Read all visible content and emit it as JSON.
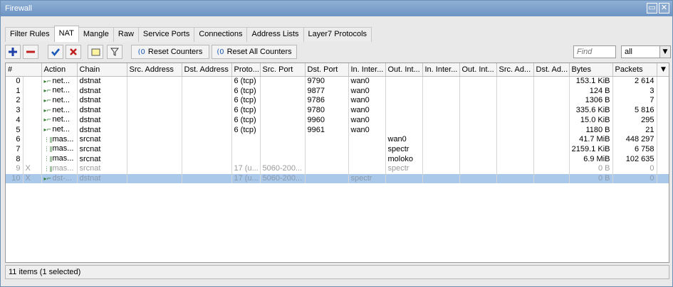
{
  "window": {
    "title": "Firewall",
    "restore_icon": "restore-icon",
    "close_icon": "close-icon"
  },
  "tabs": [
    {
      "label": "Filter Rules"
    },
    {
      "label": "NAT",
      "active": true
    },
    {
      "label": "Mangle"
    },
    {
      "label": "Raw"
    },
    {
      "label": "Service Ports"
    },
    {
      "label": "Connections"
    },
    {
      "label": "Address Lists"
    },
    {
      "label": "Layer7 Protocols"
    }
  ],
  "toolbar": {
    "reset_counters": "Reset Counters",
    "reset_all_counters": "Reset All Counters",
    "find_placeholder": "Find",
    "filter_value": "all"
  },
  "columns": [
    "#",
    "Action",
    "Chain",
    "Src. Address",
    "Dst. Address",
    "Proto...",
    "Src. Port",
    "Dst. Port",
    "In. Inter...",
    "Out. Int...",
    "In. Inter...",
    "Out. Int...",
    "Src. Ad...",
    "Dst. Ad...",
    "Bytes",
    "Packets"
  ],
  "rows": [
    {
      "num": "0",
      "flag": "",
      "action": "net...",
      "chain": "dstnat",
      "src_addr": "",
      "dst_addr": "",
      "proto": "6 (tcp)",
      "src_port": "",
      "dst_port": "9790",
      "in_if": "wan0",
      "out_if": "",
      "in_if_list": "",
      "out_if_list": "",
      "src_al": "",
      "dst_al": "",
      "bytes": "153.1 KiB",
      "packets": "2 614",
      "type": "dst"
    },
    {
      "num": "1",
      "flag": "",
      "action": "net...",
      "chain": "dstnat",
      "src_addr": "",
      "dst_addr": "",
      "proto": "6 (tcp)",
      "src_port": "",
      "dst_port": "9877",
      "in_if": "wan0",
      "out_if": "",
      "in_if_list": "",
      "out_if_list": "",
      "src_al": "",
      "dst_al": "",
      "bytes": "124 B",
      "packets": "3",
      "type": "dst"
    },
    {
      "num": "2",
      "flag": "",
      "action": "net...",
      "chain": "dstnat",
      "src_addr": "",
      "dst_addr": "",
      "proto": "6 (tcp)",
      "src_port": "",
      "dst_port": "9786",
      "in_if": "wan0",
      "out_if": "",
      "in_if_list": "",
      "out_if_list": "",
      "src_al": "",
      "dst_al": "",
      "bytes": "1306 B",
      "packets": "7",
      "type": "dst"
    },
    {
      "num": "3",
      "flag": "",
      "action": "net...",
      "chain": "dstnat",
      "src_addr": "",
      "dst_addr": "",
      "proto": "6 (tcp)",
      "src_port": "",
      "dst_port": "9780",
      "in_if": "wan0",
      "out_if": "",
      "in_if_list": "",
      "out_if_list": "",
      "src_al": "",
      "dst_al": "",
      "bytes": "335.6 KiB",
      "packets": "5 816",
      "type": "dst"
    },
    {
      "num": "4",
      "flag": "",
      "action": "net...",
      "chain": "dstnat",
      "src_addr": "",
      "dst_addr": "",
      "proto": "6 (tcp)",
      "src_port": "",
      "dst_port": "9960",
      "in_if": "wan0",
      "out_if": "",
      "in_if_list": "",
      "out_if_list": "",
      "src_al": "",
      "dst_al": "",
      "bytes": "15.0 KiB",
      "packets": "295",
      "type": "dst"
    },
    {
      "num": "5",
      "flag": "",
      "action": "net...",
      "chain": "dstnat",
      "src_addr": "",
      "dst_addr": "",
      "proto": "6 (tcp)",
      "src_port": "",
      "dst_port": "9961",
      "in_if": "wan0",
      "out_if": "",
      "in_if_list": "",
      "out_if_list": "",
      "src_al": "",
      "dst_al": "",
      "bytes": "1180 B",
      "packets": "21",
      "type": "dst"
    },
    {
      "num": "6",
      "flag": "",
      "action": "mas...",
      "chain": "srcnat",
      "src_addr": "",
      "dst_addr": "",
      "proto": "",
      "src_port": "",
      "dst_port": "",
      "in_if": "",
      "out_if": "wan0",
      "in_if_list": "",
      "out_if_list": "",
      "src_al": "",
      "dst_al": "",
      "bytes": "41.7 MiB",
      "packets": "448 297",
      "type": "mas"
    },
    {
      "num": "7",
      "flag": "",
      "action": "mas...",
      "chain": "srcnat",
      "src_addr": "",
      "dst_addr": "",
      "proto": "",
      "src_port": "",
      "dst_port": "",
      "in_if": "",
      "out_if": "spectr",
      "in_if_list": "",
      "out_if_list": "",
      "src_al": "",
      "dst_al": "",
      "bytes": "2159.1 KiB",
      "packets": "6 758",
      "type": "mas"
    },
    {
      "num": "8",
      "flag": "",
      "action": "mas...",
      "chain": "srcnat",
      "src_addr": "",
      "dst_addr": "",
      "proto": "",
      "src_port": "",
      "dst_port": "",
      "in_if": "",
      "out_if": "moloko",
      "in_if_list": "",
      "out_if_list": "",
      "src_al": "",
      "dst_al": "",
      "bytes": "6.9 MiB",
      "packets": "102 635",
      "type": "mas"
    },
    {
      "num": "9",
      "flag": "X",
      "action": "mas...",
      "chain": "srcnat",
      "src_addr": "",
      "dst_addr": "",
      "proto": "17 (u...",
      "src_port": "5060-200...",
      "dst_port": "",
      "in_if": "",
      "out_if": "spectr",
      "in_if_list": "",
      "out_if_list": "",
      "src_al": "",
      "dst_al": "",
      "bytes": "0 B",
      "packets": "0",
      "type": "mas",
      "disabled": true
    },
    {
      "num": "10",
      "flag": "X",
      "action": "dst-...",
      "chain": "dstnat",
      "src_addr": "",
      "dst_addr": "",
      "proto": "17 (u...",
      "src_port": "5060-200...",
      "dst_port": "",
      "in_if": "spectr",
      "out_if": "",
      "in_if_list": "",
      "out_if_list": "",
      "src_al": "",
      "dst_al": "",
      "bytes": "0 B",
      "packets": "0",
      "type": "dst",
      "disabled": true,
      "selected": true
    }
  ],
  "status": {
    "text": "11 items (1 selected)"
  },
  "colors": {
    "title_bar": "#6d94c3",
    "add_icon": "#1e3fa8",
    "remove_icon": "#c0211f",
    "enable_icon": "#1e5bb8",
    "disable_icon": "#c0211f",
    "selected_row": "#a9c8ea"
  }
}
